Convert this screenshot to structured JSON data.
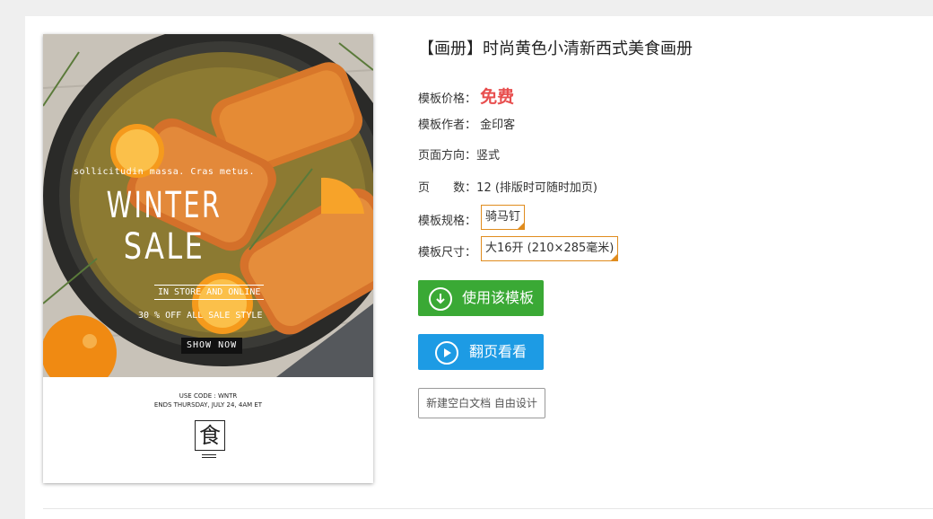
{
  "title": "【画册】时尚黄色小清新西式美食画册",
  "details": {
    "price_label": "模板价格：",
    "price_value": "免费",
    "author_label": "模板作者：",
    "author_value": "金印客",
    "orientation_label": "页面方向：",
    "orientation_value": "竖式",
    "pages_label_1": "页",
    "pages_label_2": "数：",
    "pages_value": "12 (排版时可随时加页)",
    "spec_label": "模板规格：",
    "spec_value": "骑马钉",
    "size_label": "模板尺寸：",
    "size_value": "大16开 (210×285毫米)"
  },
  "buttons": {
    "use_template": "使用该模板",
    "flip_preview": "翻页看看",
    "blank_document": "新建空白文档 自由设计"
  },
  "cover": {
    "tagline": "sollicitudin massa. Cras metus.",
    "headline_1": "WINTER",
    "headline_2": "SALE",
    "in_store": "IN STORE AND ONLINE",
    "offer": "30 % OFF ALL SALE STYLE",
    "show_now": "SHOW NOW",
    "use_code": "USE CODE : WNTR",
    "ends": "ENDS THURSDAY, JULY 24, 4AM ET",
    "logo_char": "食"
  },
  "colors": {
    "price": "#e84e4e",
    "use_button": "#3aa935",
    "flip_button": "#1d9be4",
    "tag_border": "#e08c1e"
  },
  "icons": {
    "use_button_icon": "download-circle-icon",
    "flip_button_icon": "play-circle-icon"
  }
}
